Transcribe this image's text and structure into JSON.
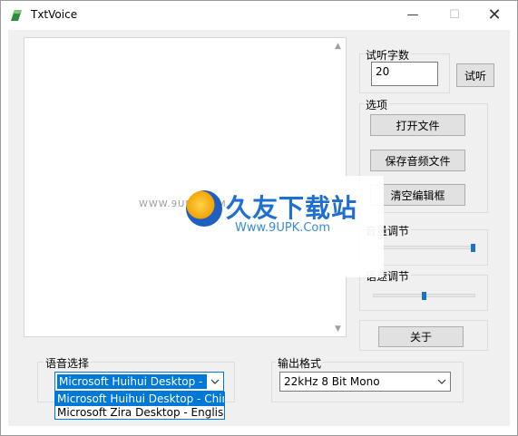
{
  "window": {
    "title": "TxtVoice",
    "minimize": "—",
    "maximize": "☐",
    "close": "✕"
  },
  "icons": [
    "app-icon",
    "minimize-icon",
    "maximize-icon",
    "close-icon",
    "scroll-up-icon",
    "scroll-down-icon",
    "chevron-down-icon"
  ],
  "editor": {
    "text": ""
  },
  "preview": {
    "group_label": "试听字数",
    "count_value": "20",
    "preview_button": "试听"
  },
  "options": {
    "group_label": "选项",
    "open_file": "打开文件",
    "save_audio": "保存音频文件",
    "clear_editor": "清空编辑框"
  },
  "volume": {
    "label": "音量调节",
    "level": 1.0
  },
  "speed": {
    "label": "语速调节",
    "level": 0.5
  },
  "about_button": "关于",
  "voice": {
    "label": "语音选择",
    "selected": "Microsoft Huihui Desktop - Chinese",
    "options": [
      "Microsoft Huihui Desktop - Chinese",
      "Microsoft Zira Desktop - English (U"
    ]
  },
  "output": {
    "label": "输出格式",
    "selected": "22kHz 8 Bit Mono"
  },
  "watermark": {
    "brand": "久友下载站",
    "url": "Www.9UPK.Com",
    "left_url": "WWW.9UPK.COM"
  },
  "colors": {
    "accent": "#0078d7",
    "background": "#f0f0f0",
    "slider_thumb": "#1a73c8"
  }
}
